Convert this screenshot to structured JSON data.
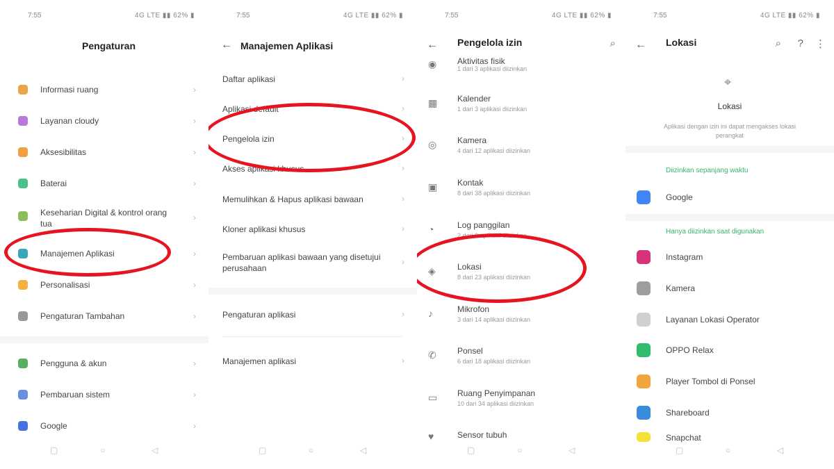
{
  "status_bar": {
    "time": "7:55",
    "right": "4G LTE ▮▮ 62% ▮"
  },
  "panel1": {
    "title": "Pengaturan",
    "items": [
      {
        "label": "Informasi ruang",
        "color": "#e8a54a"
      },
      {
        "label": "Layanan cloudy",
        "color": "#b87ad9"
      },
      {
        "label": "Aksesibilitas",
        "color": "#f0a040"
      },
      {
        "label": "Baterai",
        "color": "#4bc28a"
      },
      {
        "label": "Keseharian Digital & kontrol orang tua",
        "color": "#8cbf5a"
      },
      {
        "label": "Manajemen Aplikasi",
        "color": "#3aa7b8"
      },
      {
        "label": "Personalisasi",
        "color": "#f3b142"
      },
      {
        "label": "Pengaturan Tambahan",
        "color": "#999999"
      },
      {
        "label": "Pengguna & akun",
        "color": "#5aae62"
      },
      {
        "label": "Pembaruan sistem",
        "color": "#6b8fe0"
      },
      {
        "label": "Google",
        "color": "#4a6fe0"
      }
    ]
  },
  "panel2": {
    "title": "Manajemen Aplikasi",
    "items": [
      "Daftar aplikasi",
      "Aplikasi default",
      "Pengelola izin",
      "Akses aplikasi khusus",
      "Memulihkan & Hapus aplikasi bawaan",
      "Kloner aplikasi khusus",
      "Pembaruan aplikasi bawaan yang disetujui perusahaan",
      "Pengaturan aplikasi",
      "Manajemen aplikasi"
    ]
  },
  "panel3": {
    "title": "Pengelola izin",
    "items": [
      {
        "label": "Aktivitas fisik",
        "sub": "1 dari 3 aplikasi diizinkan",
        "icon": "◉"
      },
      {
        "label": "Kalender",
        "sub": "1 dari 3 aplikasi diizinkan",
        "icon": "▦"
      },
      {
        "label": "Kamera",
        "sub": "4 dari 12 aplikasi diizinkan",
        "icon": "◎"
      },
      {
        "label": "Kontak",
        "sub": "8 dari 38 aplikasi diizinkan",
        "icon": "▣"
      },
      {
        "label": "Log panggilan",
        "sub": "2 dari 8 aplikasi diizinkan",
        "icon": "◔"
      },
      {
        "label": "Lokasi",
        "sub": "8 dari 23 aplikasi diizinkan",
        "icon": "◈"
      },
      {
        "label": "Mikrofon",
        "sub": "3 dari 14 aplikasi diizinkan",
        "icon": "♪"
      },
      {
        "label": "Ponsel",
        "sub": "6 dari 18 aplikasi diizinkan",
        "icon": "✆"
      },
      {
        "label": "Ruang Penyimpanan",
        "sub": "10 dari 34 aplikasi diizinkan",
        "icon": "▭"
      },
      {
        "label": "Sensor tubuh",
        "sub": "",
        "icon": "♥"
      }
    ]
  },
  "panel4": {
    "title": "Lokasi",
    "header_label": "Lokasi",
    "description": "Aplikasi dengan izin ini dapat mengakses lokasi perangkat",
    "section_all_time": "Diizinkan sepanjang waktu",
    "section_in_use": "Hanya diizinkan saat digunakan",
    "all_time_apps": [
      {
        "name": "Google",
        "color": "#4285f4"
      }
    ],
    "in_use_apps": [
      {
        "name": "Instagram",
        "color": "#d6337a"
      },
      {
        "name": "Kamera",
        "color": "#9e9e9e"
      },
      {
        "name": "Layanan Lokasi Operator",
        "color": "#cfcfcf"
      },
      {
        "name": "OPPO Relax",
        "color": "#2fbd6b"
      },
      {
        "name": "Player Tombol di Ponsel",
        "color": "#f0a63a"
      },
      {
        "name": "Shareboard",
        "color": "#3a8be0"
      },
      {
        "name": "Snapchat",
        "color": "#f2e23a"
      }
    ]
  },
  "nav_icons": [
    "square-icon",
    "circle-icon",
    "triangle-icon"
  ]
}
